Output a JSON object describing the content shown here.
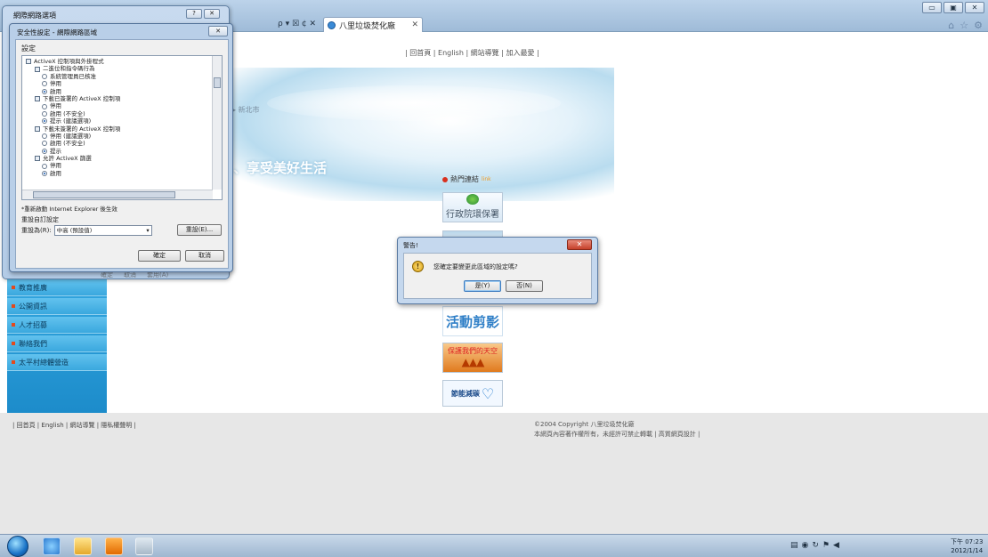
{
  "browser": {
    "address_controls": "ρ ▾ ☒ ¢ ✕",
    "tab_title": "八里垃圾焚化廠",
    "tab_close": "✕",
    "window_controls": [
      "▭",
      "▣",
      "✕"
    ],
    "toolbar_icons": [
      "home-icon",
      "star-icon",
      "gear-icon"
    ]
  },
  "page": {
    "top_nav": "| 回首頁 | English | 網站導覽 | 加入最愛 |",
    "city": "▸ 新北市",
    "slogan": "、享受美好生活",
    "sidebar": [
      "教育推廣",
      "公開資訊",
      "人才招募",
      "聯絡我們",
      "太平村總體營造"
    ],
    "hot_links_label": "熱門連結",
    "hot_links_more": "link",
    "tiles": {
      "epa": "行政院環保署",
      "activity": "活動剪影",
      "guard": "保護我們的天空",
      "energy": "節能減碳"
    },
    "footer_links": "| 回首頁 | English | 網站導覽 | 隱私權聲明 |",
    "copyright": "©2004 Copyright 八里垃圾焚化廠",
    "footnote": "本網頁內容著作權所有，未經許可禁止轉載 | 高質網頁設計 |"
  },
  "inet_options": {
    "title": "網際網路選項",
    "controls": [
      "?",
      "✕"
    ],
    "ghost_buttons": [
      "確定",
      "取消",
      "套用(A)"
    ]
  },
  "security_settings": {
    "title": "安全性設定 - 網際網路區域",
    "close": "✕",
    "settings_label": "設定",
    "tree": [
      {
        "level": 1,
        "kind": "check",
        "text": "ActiveX 控制項與外掛程式"
      },
      {
        "level": 2,
        "kind": "check",
        "text": "二進位和指令碼行為"
      },
      {
        "level": 3,
        "kind": "radio",
        "on": false,
        "text": "系統管理員已核准"
      },
      {
        "level": 3,
        "kind": "radio",
        "on": false,
        "text": "停用"
      },
      {
        "level": 3,
        "kind": "radio",
        "on": true,
        "text": "啟用"
      },
      {
        "level": 2,
        "kind": "check",
        "text": "下載已簽署的 ActiveX 控制項"
      },
      {
        "level": 3,
        "kind": "radio",
        "on": false,
        "text": "停用"
      },
      {
        "level": 3,
        "kind": "radio",
        "on": false,
        "text": "啟用 (不安全)"
      },
      {
        "level": 3,
        "kind": "radio",
        "on": true,
        "text": "提示 (建議選項)"
      },
      {
        "level": 2,
        "kind": "check",
        "text": "下載未簽署的 ActiveX 控制項"
      },
      {
        "level": 3,
        "kind": "radio",
        "on": false,
        "text": "停用 (建議選項)"
      },
      {
        "level": 3,
        "kind": "radio",
        "on": false,
        "text": "啟用 (不安全)"
      },
      {
        "level": 3,
        "kind": "radio",
        "on": true,
        "text": "提示"
      },
      {
        "level": 2,
        "kind": "check",
        "text": "允許 ActiveX 篩選"
      },
      {
        "level": 3,
        "kind": "radio",
        "on": false,
        "text": "停用"
      },
      {
        "level": 3,
        "kind": "radio",
        "on": true,
        "text": "啟用"
      }
    ],
    "restart_note": "*重新啟動 Internet Explorer 後生效",
    "reset_label": "重設自訂設定",
    "reset_to_label": "重設為(R):",
    "reset_to_value": "中高 (預設值)",
    "reset_button": "重設(E)...",
    "ok": "確定",
    "cancel": "取消"
  },
  "warning": {
    "title": "警告!",
    "close": "✕",
    "message": "您確定要變更此區域的設定嗎?",
    "yes": "是(Y)",
    "no": "否(N)"
  },
  "taskbar": {
    "tray_icons": [
      "network-icon",
      "security-icon",
      "sync-icon",
      "flag-icon",
      "volume-icon"
    ],
    "time": "下午 07:23",
    "date": "2012/1/14"
  }
}
